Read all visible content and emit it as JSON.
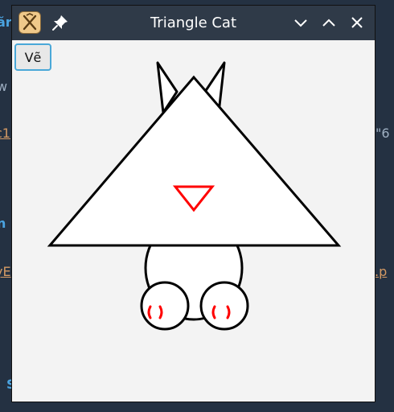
{
  "window": {
    "title": "Triangle Cat"
  },
  "toolbar": {
    "draw_label": "Vẽ"
  },
  "colors": {
    "titlebar": "#2f3a48",
    "client_bg": "#f3f3f3",
    "outline": "#000000",
    "accent": "#ff0000",
    "focus_ring": "#4aa8d8"
  },
  "icons": [
    "app-icon",
    "pin-icon",
    "minimize-icon",
    "maximize-icon",
    "close-icon"
  ]
}
